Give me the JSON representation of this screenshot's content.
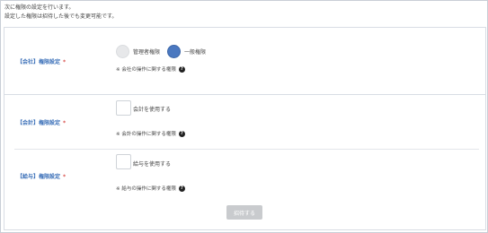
{
  "intro": {
    "line1": "次に権限の設定を行います。",
    "line2": "設定した権限は招待した後でも変更可能です。"
  },
  "company": {
    "label": "【会社】権限設定",
    "required": "*",
    "options": [
      {
        "label": "管理者権限",
        "selected": false
      },
      {
        "label": "一般権限",
        "selected": true
      }
    ],
    "note": "※ 会社の操作に関する権限"
  },
  "accounting": {
    "label": "【会計】権限設定",
    "required": "*",
    "checkbox_label": "会計を使用する",
    "note": "※ 会計の操作に関する権限"
  },
  "payroll": {
    "label": "【給与】権限設定",
    "required": "*",
    "checkbox_label": "給与を使用する",
    "note": "※ 給与の操作に関する権限"
  },
  "help_glyph": "?",
  "submit_label": "招待する",
  "colors": {
    "accent": "#4a78c0",
    "label_blue": "#3a6fb8",
    "required_red": "#d9534f",
    "disabled_button": "#c9cbce"
  }
}
